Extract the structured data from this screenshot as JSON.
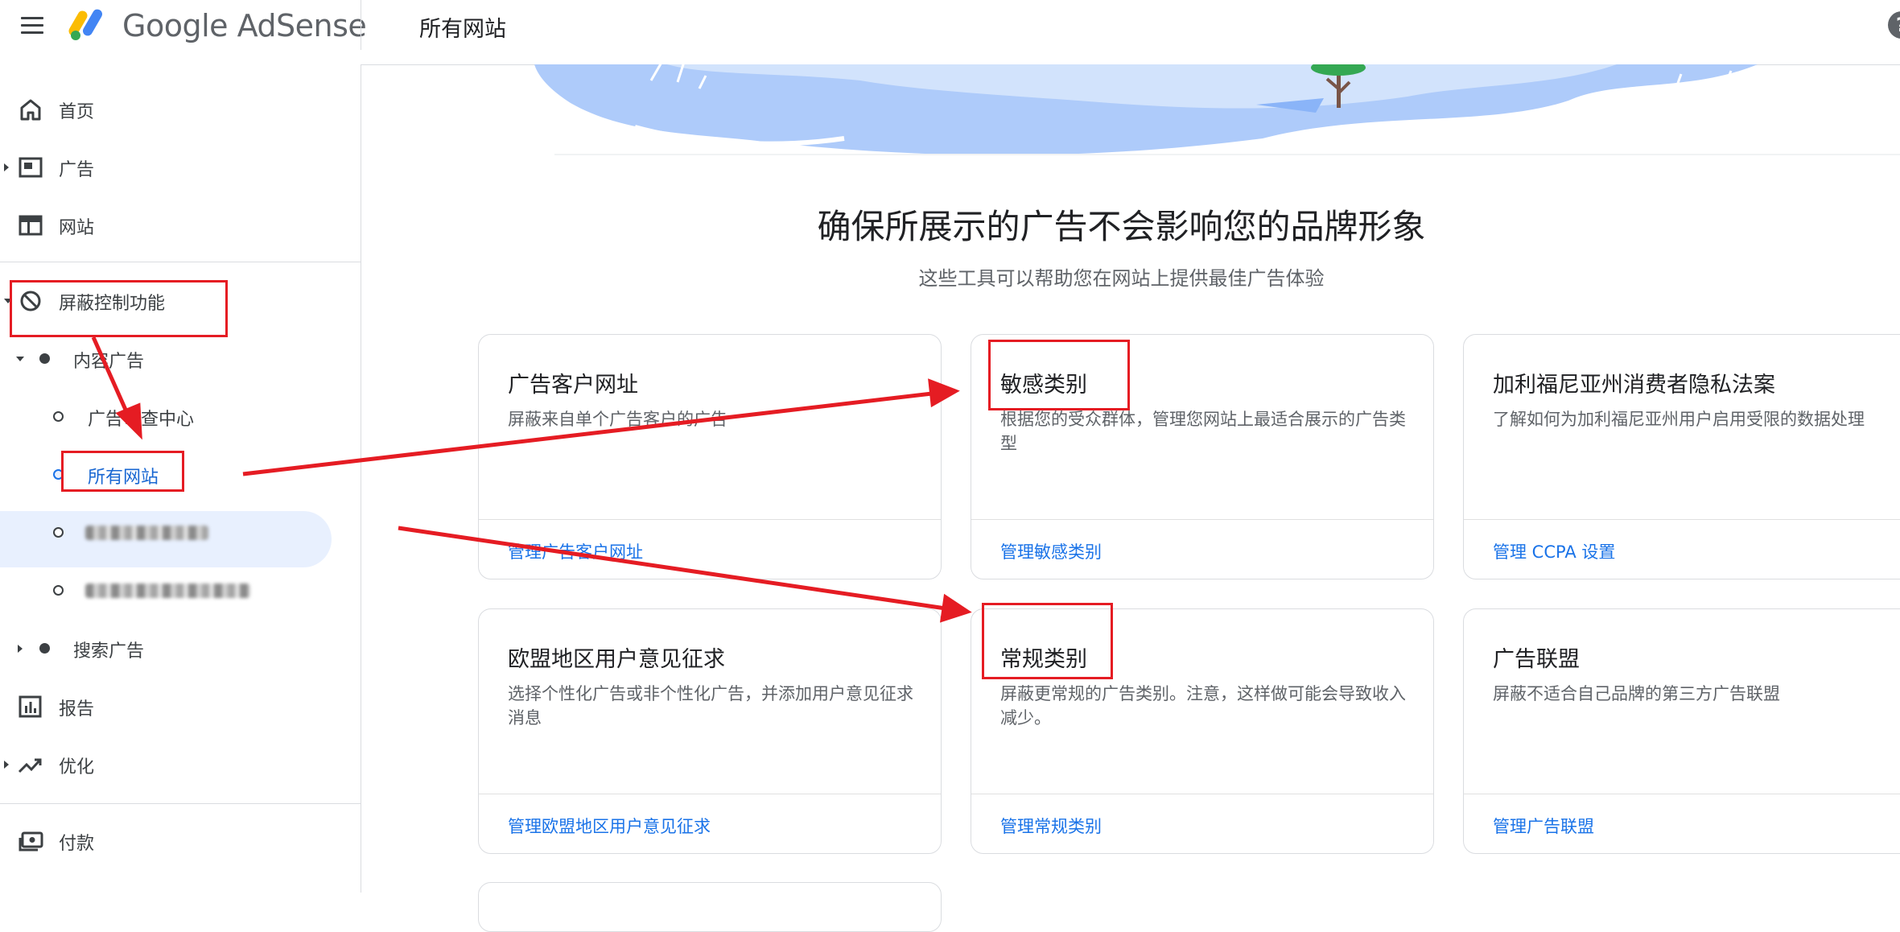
{
  "header": {
    "brand": "Google AdSense",
    "page_title": "所有网站",
    "help_glyph": "?"
  },
  "sidebar": {
    "items": [
      {
        "label": "首页",
        "icon": "home-icon"
      },
      {
        "label": "广告",
        "icon": "ads-icon"
      },
      {
        "label": "网站",
        "icon": "sites-icon"
      },
      {
        "label": "屏蔽控制功能",
        "icon": "block-icon"
      },
      {
        "label": "内容广告",
        "icon": "bullet-icon"
      },
      {
        "label": "广告审查中心",
        "icon": "circle-icon"
      },
      {
        "label": "所有网站",
        "icon": "circle-icon",
        "active": true
      },
      {
        "label": "搜索广告",
        "icon": "bullet-icon"
      },
      {
        "label": "报告",
        "icon": "report-icon"
      },
      {
        "label": "优化",
        "icon": "trend-icon"
      },
      {
        "label": "付款",
        "icon": "payments-icon"
      }
    ]
  },
  "main": {
    "headline": "确保所展示的广告不会影响您的品牌形象",
    "subheadline": "这些工具可以帮助您在网站上提供最佳广告体验",
    "cards": [
      {
        "title": "广告客户网址",
        "desc": "屏蔽来自单个广告客户的广告",
        "link": "管理广告客户网址"
      },
      {
        "title": "敏感类别",
        "desc": "根据您的受众群体，管理您网站上最适合展示的广告类型",
        "link": "管理敏感类别"
      },
      {
        "title": "加利福尼亚州消费者隐私法案",
        "desc": "了解如何为加利福尼亚州用户启用受限的数据处理",
        "link": "管理 CCPA 设置"
      },
      {
        "title": "欧盟地区用户意见征求",
        "desc": "选择个性化广告或非个性化广告，并添加用户意见征求消息",
        "link": "管理欧盟地区用户意见征求"
      },
      {
        "title": "常规类别",
        "desc": "屏蔽更常规的广告类别。注意，这样做可能会导致收入减少。",
        "link": "管理常规类别"
      },
      {
        "title": "广告联盟",
        "desc": "屏蔽不适合自己品牌的第三方广告联盟",
        "link": "管理广告联盟"
      }
    ]
  },
  "colors": {
    "link": "#1a73e8",
    "active_bg": "#e8f0fe",
    "annotation": "#e51c23",
    "hero": "#aecbfa"
  }
}
